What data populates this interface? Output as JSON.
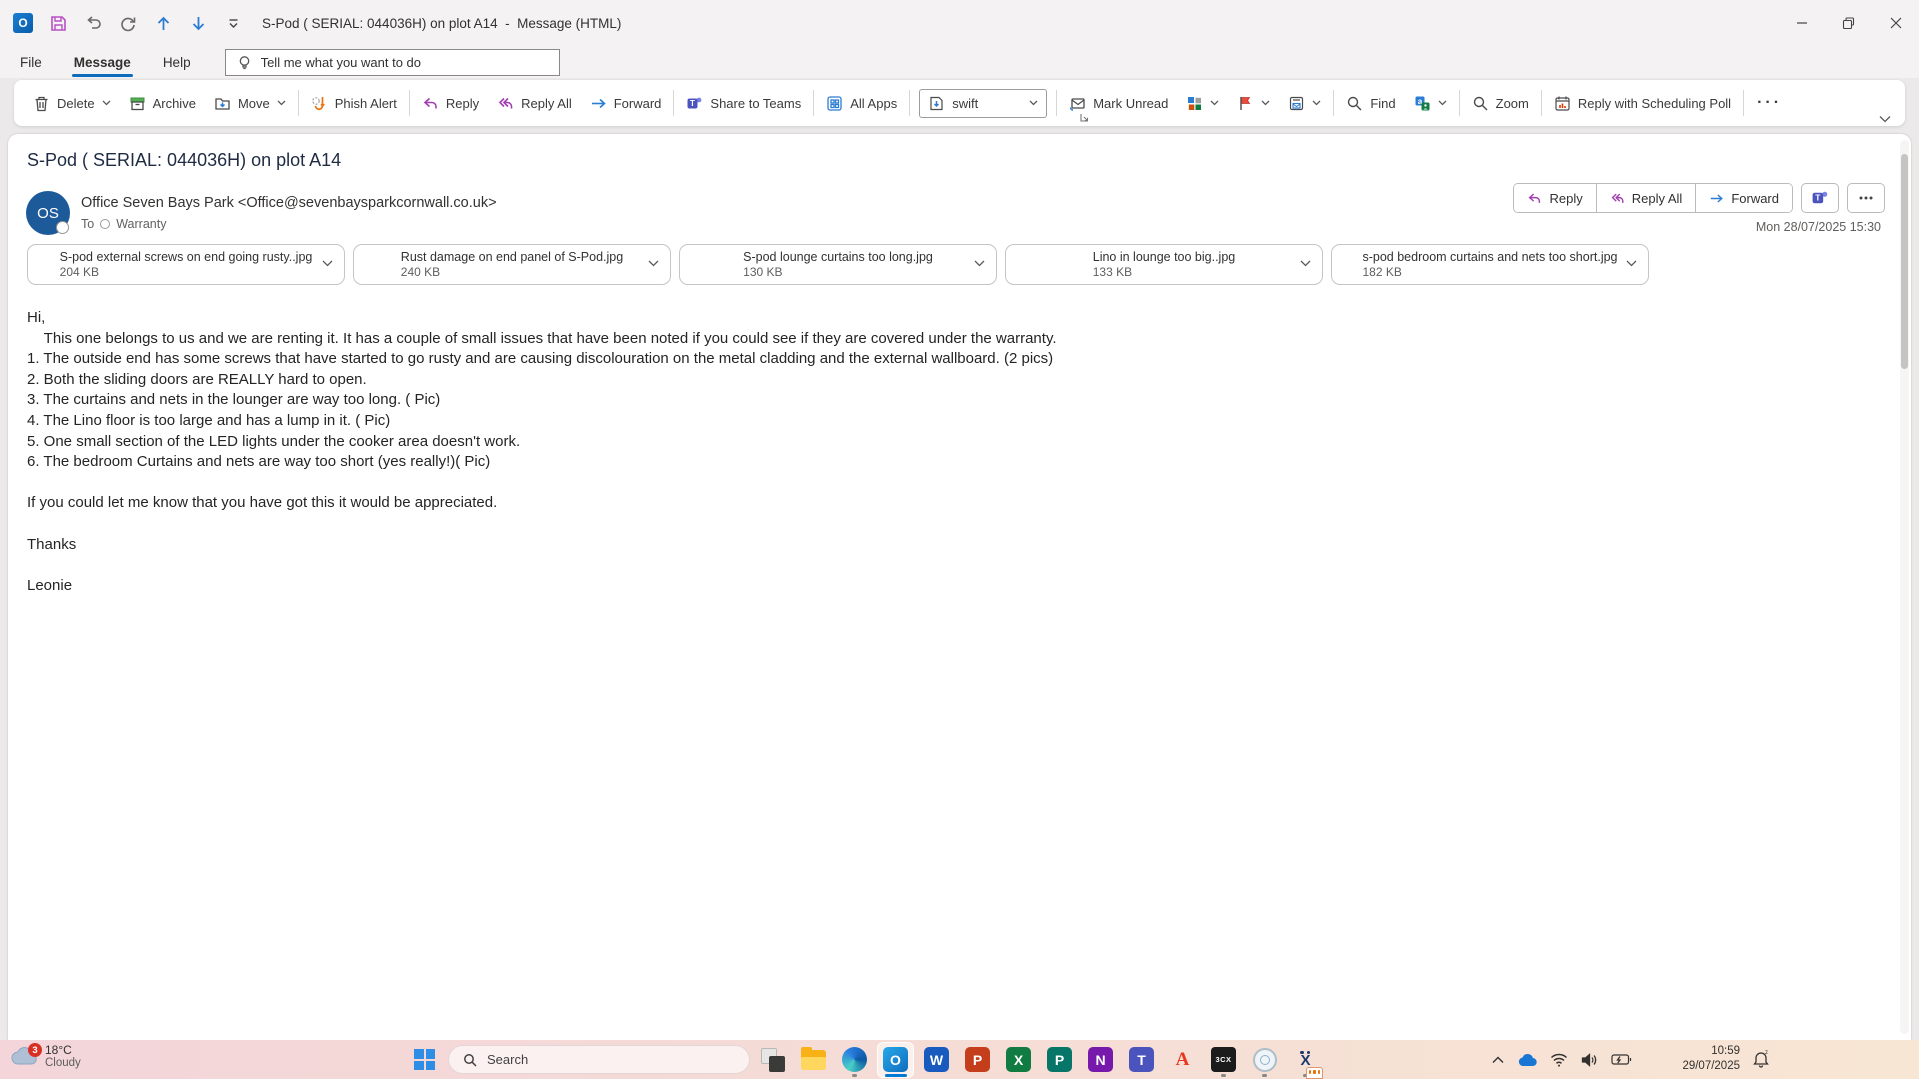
{
  "colors": {
    "accent_blue": "#0f6cbd",
    "forward_blue": "#2b7cd3",
    "reply_purple": "#a23fb0",
    "avatar_blue": "#1d5a9a",
    "flag_red": "#d13438",
    "phish_orange": "#e8720c",
    "taskbar_left": "#f3d5da",
    "taskbar_right": "#f8e6d4",
    "active_indicator": "#0078d4"
  },
  "titlebar": {
    "title": "S-Pod ( SERIAL: 044036H) on plot A14  -  Message (HTML)"
  },
  "menu": {
    "file": "File",
    "message": "Message",
    "help": "Help",
    "tell_me": "Tell me what you want to do"
  },
  "ribbon": {
    "delete": "Delete",
    "archive": "Archive",
    "move": "Move",
    "phish_alert": "Phish Alert",
    "reply": "Reply",
    "reply_all": "Reply All",
    "forward": "Forward",
    "share_to_teams": "Share to Teams",
    "all_apps": "All Apps",
    "quick_step": "swift",
    "mark_unread": "Mark Unread",
    "find": "Find",
    "zoom": "Zoom",
    "scheduling_poll": "Reply with Scheduling Poll",
    "more": "···"
  },
  "header": {
    "subject": "S-Pod ( SERIAL: 044036H) on plot A14",
    "avatar_initials": "OS",
    "sender": "Office Seven Bays Park <Office@sevenbaysparkcornwall.co.uk>",
    "to_label": "To",
    "recipient": "Warranty",
    "reply": "Reply",
    "reply_all": "Reply All",
    "forward": "Forward",
    "date": "Mon 28/07/2025 15:30"
  },
  "attachments": [
    {
      "name": "S-pod external screws on end going rusty..jpg",
      "size": "204 KB"
    },
    {
      "name": "Rust damage on end panel of S-Pod.jpg",
      "size": "240 KB"
    },
    {
      "name": "S-pod lounge curtains too long.jpg",
      "size": "130 KB"
    },
    {
      "name": "Lino in lounge too big..jpg",
      "size": "133 KB"
    },
    {
      "name": "s-pod bedroom curtains and nets too short.jpg",
      "size": "182 KB"
    }
  ],
  "body_lines": [
    "Hi,",
    "    This one belongs to us and we are renting it. It has a couple of small issues that have been noted if you could see if they are covered under the warranty.",
    "1. The outside end has some screws that have started to go rusty and are causing discolouration on the metal cladding and the external wallboard. (2 pics)",
    "2. Both the sliding doors are REALLY hard to open.",
    "3. The curtains and nets in the lounger are way too long. ( Pic)",
    "4. The Lino floor is too large and has a lump in it. ( Pic)",
    "5. One small section of the LED lights under the cooker area doesn't work.",
    "6. The bedroom Curtains and nets are way too short (yes really!)( Pic)",
    "",
    "If you could let me know that you have got this it would be appreciated.",
    "",
    "Thanks",
    "",
    "Leonie"
  ],
  "glyphs": {
    "outlook": "O",
    "word": "W",
    "excel": "X",
    "powerpoint": "P",
    "publisher": "P",
    "onenote": "N",
    "teams": "T",
    "adobe": "A",
    "cx": "3CX",
    "x_app": "X",
    "translate_a": "a"
  },
  "taskbar": {
    "weather_badge": "3",
    "temp": "18°C",
    "condition": "Cloudy",
    "search_placeholder": "Search",
    "time": "10:59",
    "date": "29/07/2025"
  }
}
